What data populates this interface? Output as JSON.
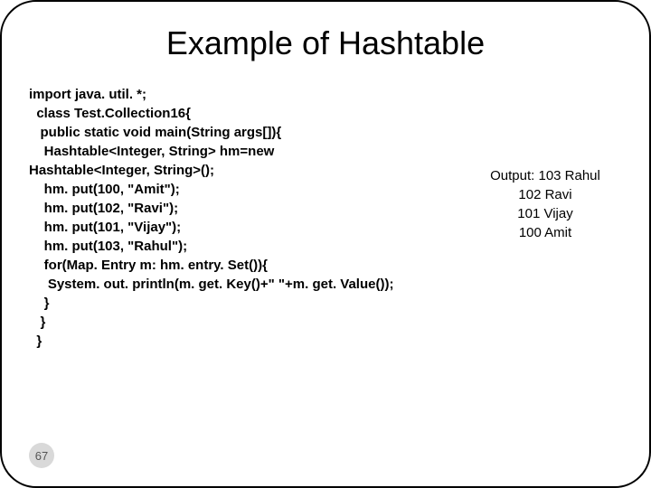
{
  "title": "Example of Hashtable",
  "code": {
    "l1": "import java. util. *;",
    "l2": "  class Test.Collection16{",
    "l3": "   public static void main(String args[]){",
    "l4": "",
    "l5": "    Hashtable<Integer, String> hm=new",
    "l6": "Hashtable<Integer, String>();",
    "l7": "",
    "l8": "    hm. put(100, \"Amit\");",
    "l9": "    hm. put(102, \"Ravi\");",
    "l10": "    hm. put(101, \"Vijay\");",
    "l11": "    hm. put(103, \"Rahul\");",
    "l12": "",
    "l13": "    for(Map. Entry m: hm. entry. Set()){",
    "l14": "     System. out. println(m. get. Key()+\" \"+m. get. Value());",
    "l15": "    }",
    "l16": "   }",
    "l17": "  }"
  },
  "output": {
    "l1": "Output: 103 Rahul",
    "l2": "102 Ravi",
    "l3": "101 Vijay",
    "l4": "100 Amit"
  },
  "page_number": "67"
}
